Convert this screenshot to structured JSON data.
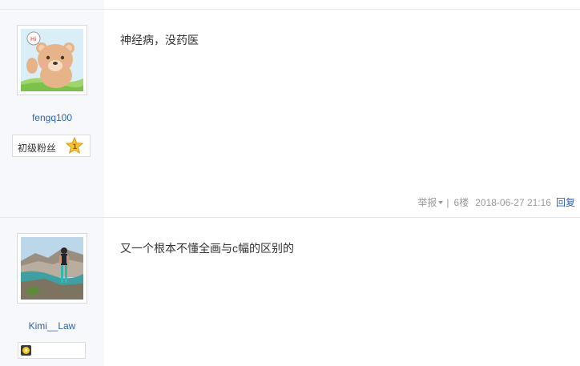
{
  "posts": [
    {
      "username": "fengq100",
      "badge_label": "初级粉丝",
      "badge_level": "1",
      "content": "神经病，没药医",
      "report_label": "举报",
      "floor": "6楼",
      "time": "2018-06-27 21:16",
      "reply_label": "回复"
    },
    {
      "username": "Kimi__Law",
      "content": "又一个根本不懂全画与c幅的区别的"
    }
  ],
  "colors": {
    "link": "#2d64b3",
    "sidebar_bg": "#f6f8fb",
    "meta_text": "#999999"
  },
  "icons": {
    "avatar_1": "cartoon-bear-avatar",
    "avatar_2": "photo-avatar",
    "badge_star": "star-level-icon",
    "badge_2": "gold-medal-icon"
  }
}
